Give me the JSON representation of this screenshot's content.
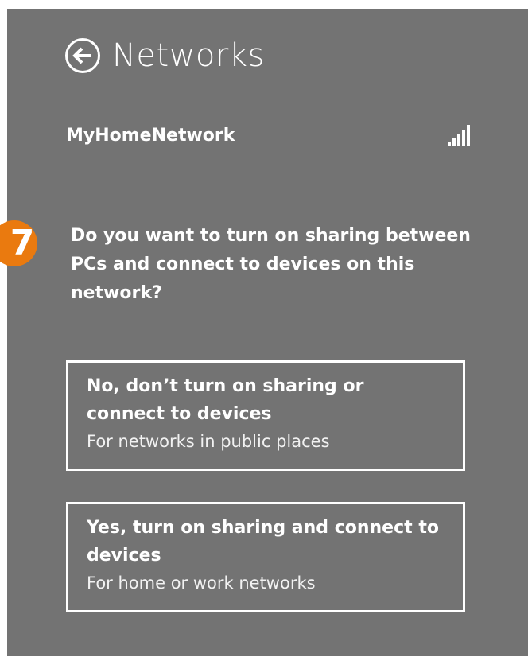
{
  "header": {
    "title": "Networks"
  },
  "network": {
    "name": "MyHomeNetwork"
  },
  "step": {
    "number": "7"
  },
  "question": "Do you want to turn on sharing between PCs and connect to devices on this network?",
  "options": [
    {
      "title": "No, don’t turn on sharing or connect to devices",
      "subtitle": "For networks in public places"
    },
    {
      "title": "Yes, turn on sharing and connect to devices",
      "subtitle": "For home or work networks"
    }
  ],
  "colors": {
    "panel_bg": "#737373",
    "badge": "#ea7a0f",
    "text": "#ffffff"
  },
  "icons": {
    "back": "back-arrow-circle-icon",
    "signal": "wifi-signal-bars-icon"
  }
}
